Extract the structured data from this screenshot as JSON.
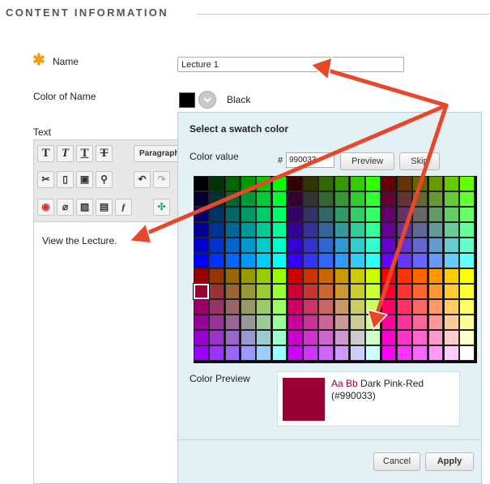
{
  "section": {
    "title": "CONTENT INFORMATION"
  },
  "form": {
    "name_label": "Name",
    "name_value": "Lecture 1",
    "color_label": "Color of Name",
    "color_value_name": "Black",
    "text_label": "Text"
  },
  "editor": {
    "toolbar_row1": [
      "T",
      "T",
      "T",
      "T"
    ],
    "paragraph_label": "Paragraph",
    "content": "View the Lecture."
  },
  "dialog": {
    "title": "Select a swatch color",
    "color_value_label": "Color value",
    "hash": "#",
    "hex_value": "990033",
    "preview_button": "Preview",
    "skip_button": "Skip",
    "color_preview_label": "Color Preview",
    "preview_sample": "Aa Bb",
    "preview_name": "Dark Pink-Red",
    "preview_hex": "(#990033)",
    "cancel_button": "Cancel",
    "apply_button": "Apply",
    "selected_color": "#990033"
  },
  "colors": {
    "accent": "#f39c12",
    "dialog_bg": "#e3f0f4",
    "arrow": "#e8472c"
  }
}
